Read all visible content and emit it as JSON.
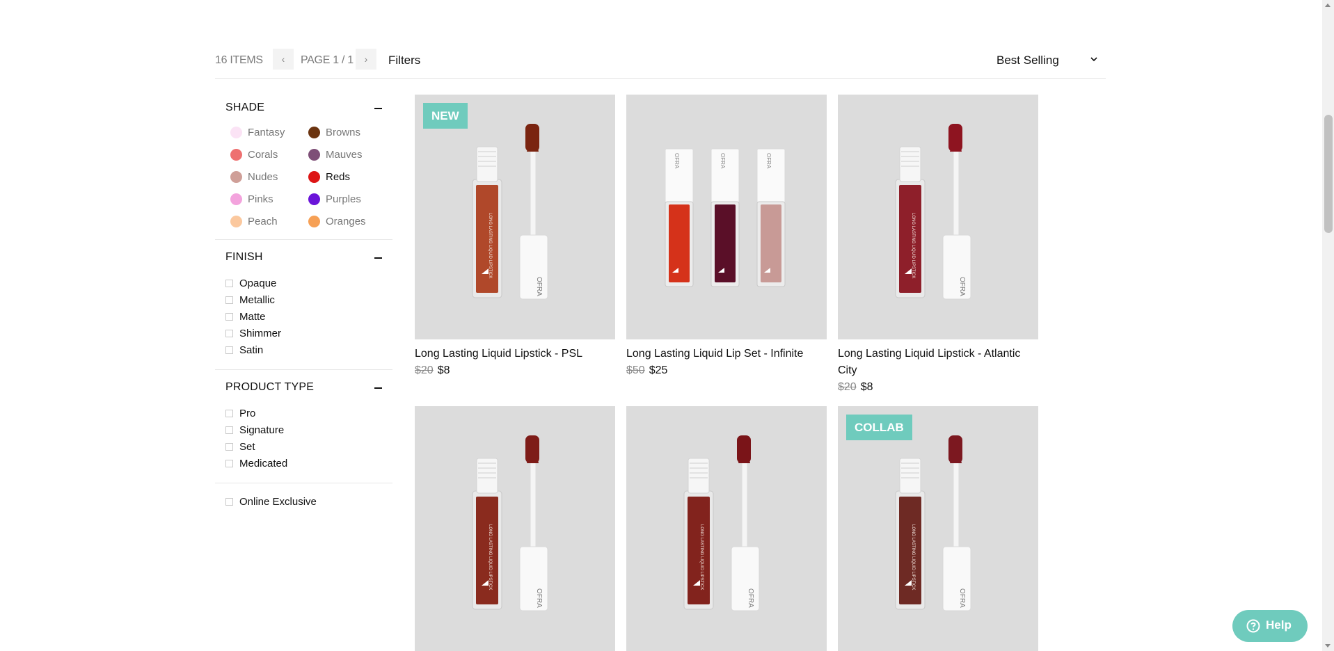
{
  "toolbar": {
    "items_count": "16 ITEMS",
    "prev_icon": "chevron-left-icon",
    "page_label": "PAGE 1 / 1",
    "next_icon": "chevron-right-icon",
    "filters_label": "Filters",
    "sort_value": "Best Selling",
    "sort_icon": "chevron-down-icon"
  },
  "filters": {
    "shade": {
      "title": "SHADE",
      "toggle_icon": "minus-icon",
      "items": [
        {
          "label": "Fantasy",
          "color": "#fbe3f5"
        },
        {
          "label": "Browns",
          "color": "#6b3410"
        },
        {
          "label": "Corals",
          "color": "#ee7070"
        },
        {
          "label": "Mauves",
          "color": "#7e4f77"
        },
        {
          "label": "Nudes",
          "color": "#cf9f98"
        },
        {
          "label": "Reds",
          "color": "#dd1515"
        },
        {
          "label": "Pinks",
          "color": "#f3a3dd"
        },
        {
          "label": "Purples",
          "color": "#6a14d9"
        },
        {
          "label": "Peach",
          "color": "#fbc89e"
        },
        {
          "label": "Oranges",
          "color": "#f6a055"
        }
      ]
    },
    "finish": {
      "title": "FINISH",
      "toggle_icon": "minus-icon",
      "items": [
        "Opaque",
        "Metallic",
        "Matte",
        "Shimmer",
        "Satin"
      ]
    },
    "product_type": {
      "title": "PRODUCT TYPE",
      "toggle_icon": "minus-icon",
      "items": [
        "Pro",
        "Signature",
        "Set",
        "Medicated"
      ]
    },
    "online_exclusive": "Online Exclusive"
  },
  "products": [
    {
      "badge": "NEW",
      "title": "Long Lasting Liquid Lipstick - PSL",
      "old_price": "$20",
      "price": "$8",
      "color": "#b0482a",
      "applicator": "#7a2410",
      "type": "single"
    },
    {
      "badge": "",
      "title": "Long Lasting Liquid Lip Set - Infinite",
      "old_price": "$50",
      "price": "$25",
      "type": "set",
      "colors": [
        "#d5321a",
        "#5a0f28",
        "#c89a96"
      ]
    },
    {
      "badge": "",
      "title": "Long Lasting Liquid Lipstick - Atlantic City",
      "old_price": "$20",
      "price": "$8",
      "color": "#8e1f2a",
      "applicator": "#8e1420",
      "type": "single"
    },
    {
      "badge": "",
      "title": "",
      "old_price": "",
      "price": "",
      "color": "#8a2b1e",
      "applicator": "#7e1c18",
      "type": "single"
    },
    {
      "badge": "",
      "title": "",
      "old_price": "",
      "price": "",
      "color": "#82231d",
      "applicator": "#7a1418",
      "type": "single"
    },
    {
      "badge": "COLLAB",
      "title": "",
      "old_price": "",
      "price": "",
      "color": "#6e2a24",
      "applicator": "#7c1820",
      "type": "single"
    }
  ],
  "brand_text": "OFRA",
  "tube_text": "LONG LASTING LIQUID LIPSTICK",
  "help": {
    "label": "Help",
    "icon": "question-circle-icon"
  }
}
